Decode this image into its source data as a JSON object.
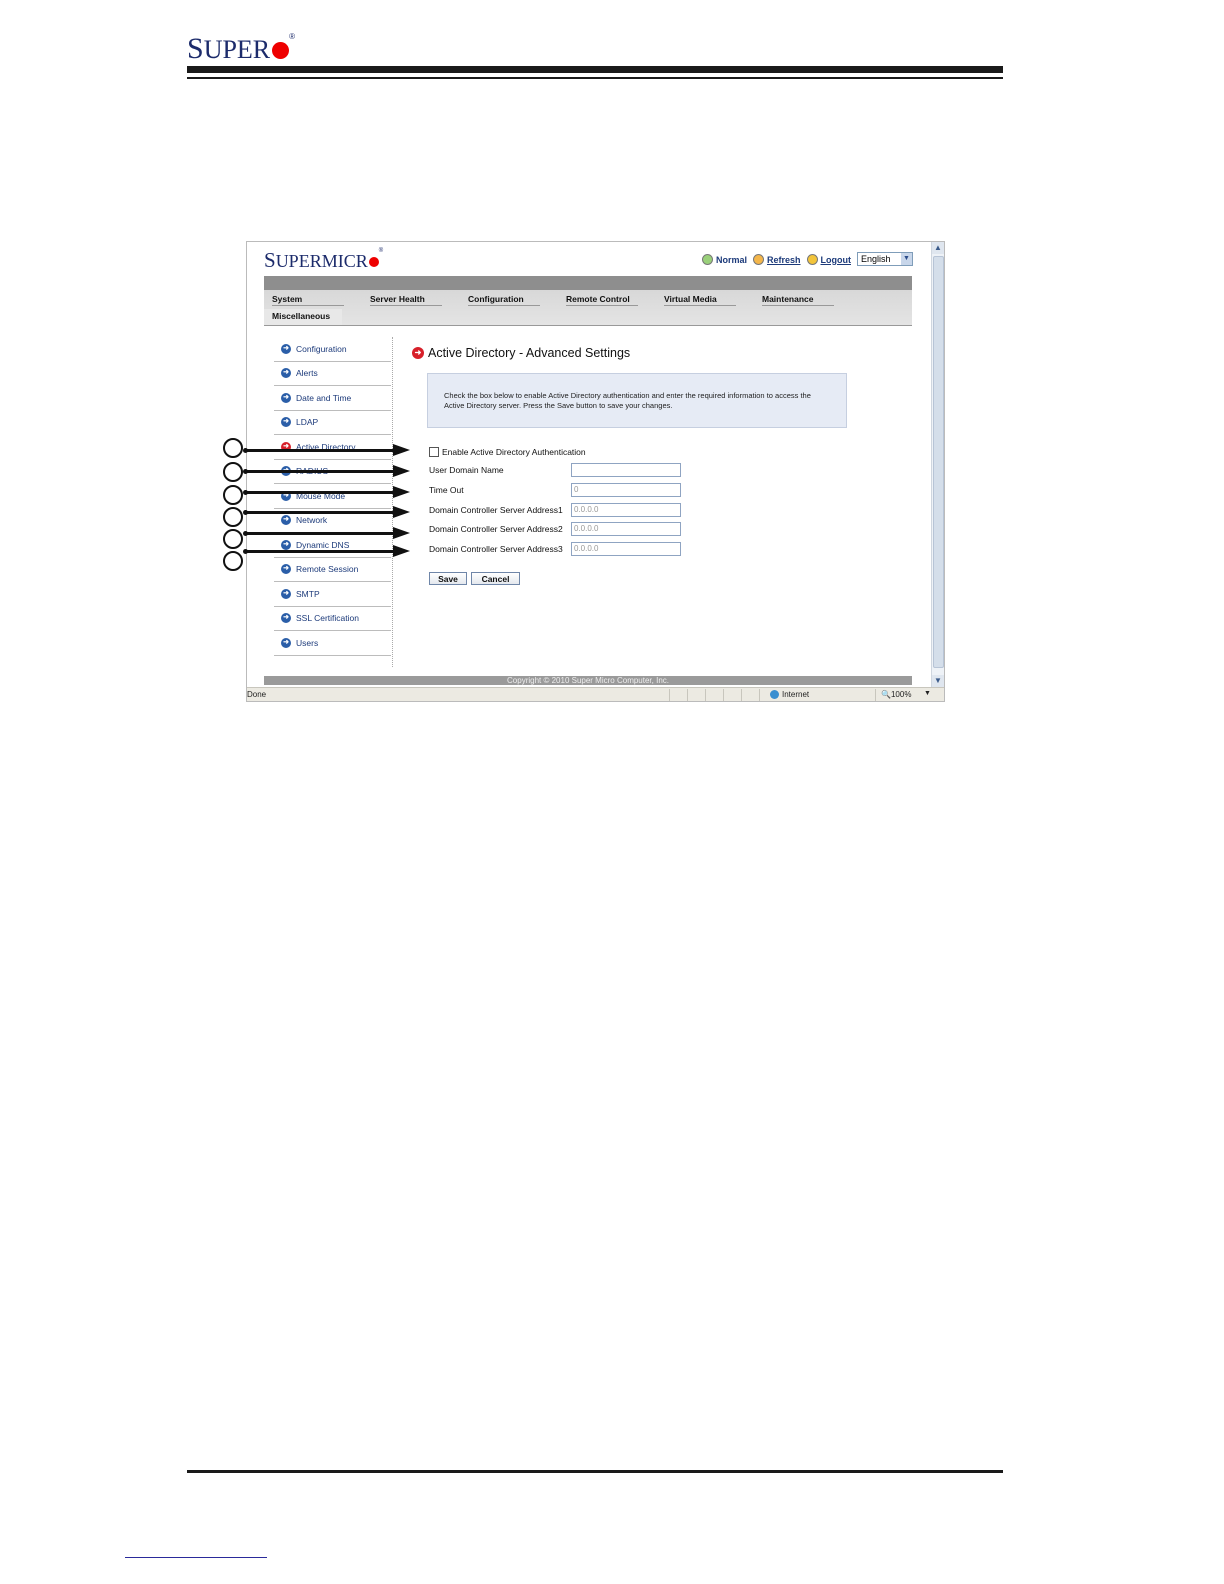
{
  "doc": {
    "logo_s": "S",
    "logo_rest": "UPER",
    "logo_reg": "®"
  },
  "app": {
    "logo_s": "S",
    "logo_rest": "UPERMICR",
    "logo_reg": "®",
    "status_label": "Normal",
    "refresh_label": "Refresh",
    "logout_label": "Logout",
    "language": "English"
  },
  "nav": {
    "tabs": [
      "System",
      "Server Health",
      "Configuration",
      "Remote Control",
      "Virtual Media",
      "Maintenance"
    ],
    "misc": "Miscellaneous"
  },
  "sidebar": {
    "items": [
      "Configuration",
      "Alerts",
      "Date and Time",
      "LDAP",
      "Active Directory",
      "RADIUS",
      "Mouse Mode",
      "Network",
      "Dynamic DNS",
      "Remote Session",
      "SMTP",
      "SSL Certification",
      "Users"
    ],
    "active_index": 4
  },
  "main": {
    "title": "Active Directory - Advanced Settings",
    "info_line1": "Check the box below to enable Active Directory authentication and enter the required information to access the",
    "info_line2": "Active Directory server. Press the Save button to save your changes.",
    "enable_label": "Enable Active Directory Authentication",
    "fields": [
      {
        "label": "User Domain Name",
        "value": ""
      },
      {
        "label": "Time Out",
        "value": "0"
      },
      {
        "label": "Domain Controller Server Address1",
        "value": "0.0.0.0"
      },
      {
        "label": "Domain Controller Server Address2",
        "value": "0.0.0.0"
      },
      {
        "label": "Domain Controller Server Address3",
        "value": "0.0.0.0"
      }
    ],
    "save_label": "Save",
    "cancel_label": "Cancel"
  },
  "footer": {
    "copyright": "Copyright © 2010 Super Micro Computer, Inc."
  },
  "browser_status": {
    "done": "Done",
    "zone": "Internet",
    "zoom": "100%"
  }
}
